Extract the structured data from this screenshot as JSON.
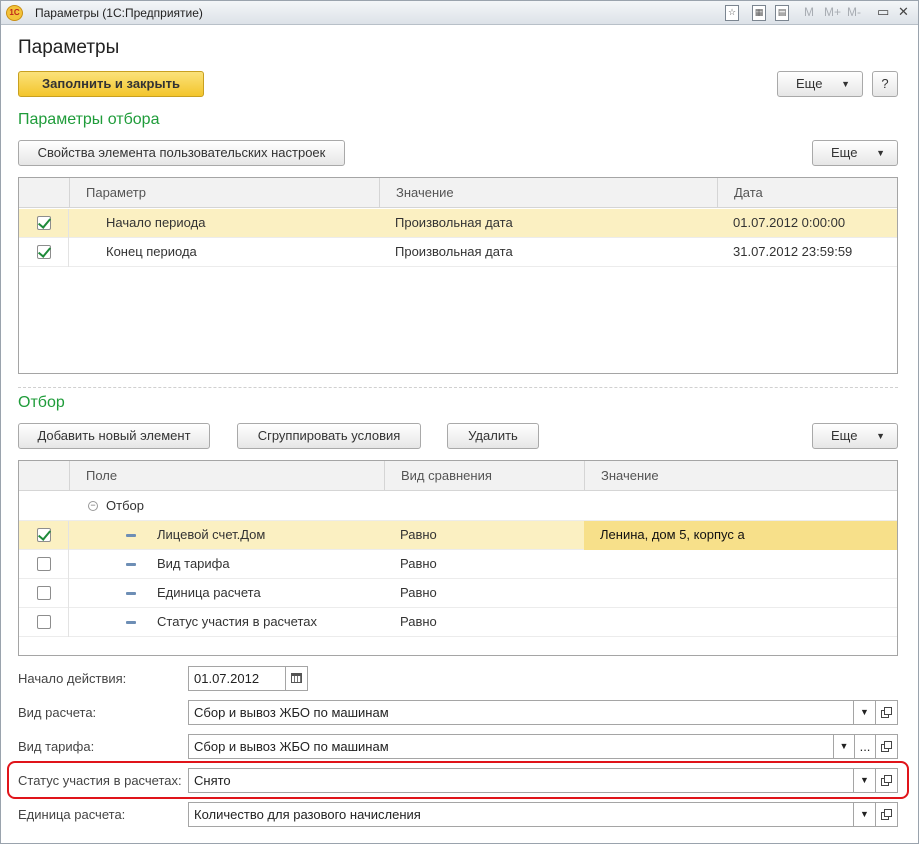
{
  "window": {
    "title": "Параметры  (1С:Предприятие)",
    "app_icon_text": "1C",
    "toolbar_m": "M",
    "toolbar_mplus": "M+",
    "toolbar_mminus": "M-"
  },
  "form": {
    "title": "Параметры",
    "fill_close_label": "Заполнить и закрыть",
    "more_label": "Еще",
    "help_label": "?"
  },
  "params_section": {
    "title": "Параметры отбора",
    "properties_button": "Свойства элемента пользовательских настроек",
    "more_label": "Еще",
    "columns": [
      "Параметр",
      "Значение",
      "Дата"
    ],
    "rows": [
      {
        "checked": true,
        "param": "Начало периода",
        "value": "Произвольная дата",
        "date": "01.07.2012 0:00:00",
        "selected": true
      },
      {
        "checked": true,
        "param": "Конец периода",
        "value": "Произвольная дата",
        "date": "31.07.2012 23:59:59",
        "selected": false
      }
    ]
  },
  "filter_section": {
    "title": "Отбор",
    "add_button": "Добавить новый элемент",
    "group_button": "Сгруппировать условия",
    "delete_button": "Удалить",
    "more_label": "Еще",
    "columns": [
      "Поле",
      "Вид сравнения",
      "Значение"
    ],
    "group_row": "Отбор",
    "rows": [
      {
        "checked": true,
        "field": "Лицевой счет.Дом",
        "comparison": "Равно",
        "value": "Ленина, дом 5, корпус а",
        "selected": true
      },
      {
        "checked": false,
        "field": "Вид тарифа",
        "comparison": "Равно",
        "value": "",
        "selected": false
      },
      {
        "checked": false,
        "field": "Единица расчета",
        "comparison": "Равно",
        "value": "",
        "selected": false
      },
      {
        "checked": false,
        "field": "Статус участия в расчетах",
        "comparison": "Равно",
        "value": "",
        "selected": false
      }
    ]
  },
  "fields": {
    "start_label": "Начало действия:",
    "start_value": "01.07.2012",
    "calc_type_label": "Вид расчета:",
    "calc_type_value": "Сбор и вывоз ЖБО по машинам",
    "tariff_label": "Вид тарифа:",
    "tariff_value": "Сбор и вывоз ЖБО по машинам",
    "status_label": "Статус участия в расчетах:",
    "status_value": "Снято",
    "unit_label": "Единица расчета:",
    "unit_value": "Количество для разового начисления",
    "ellipsis": "..."
  },
  "colors": {
    "section_title": "#1f9c3a",
    "selected_row": "#fbf0c2",
    "default_button": "#f3c52c",
    "highlight_border": "#e0141a"
  },
  "icons": [
    "app-1c-icon",
    "favorite-icon",
    "calculator-icon",
    "calendar-icon",
    "restore-icon",
    "close-icon",
    "checkbox-icon",
    "minus-icon",
    "dash-icon",
    "open-icon",
    "dropdown-icon"
  ]
}
